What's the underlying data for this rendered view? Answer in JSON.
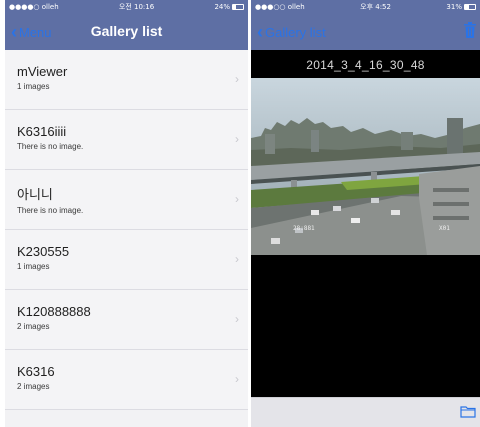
{
  "left": {
    "status": {
      "carrier": "●●●●○ olleh",
      "time": "오전 10:16",
      "battery": "24%"
    },
    "nav": {
      "back_label": "Menu",
      "title": "Gallery list"
    },
    "galleries": [
      {
        "name": "mViewer",
        "detail": "1 images"
      },
      {
        "name": "K6316iiii",
        "detail": "There is no image."
      },
      {
        "name": "아니니",
        "detail": "There is no image."
      },
      {
        "name": "K230555",
        "detail": "1 images"
      },
      {
        "name": "K120888888",
        "detail": "2 images"
      },
      {
        "name": "K6316",
        "detail": "2 images"
      }
    ]
  },
  "right": {
    "status": {
      "carrier": "●●●○○ olleh",
      "time": "오후 4:52",
      "battery": "31%"
    },
    "nav": {
      "back_label": "Gallery list"
    },
    "image_title": "2014_3_4_16_30_48",
    "overlay_labels": {
      "left": "28:881",
      "right": "X01"
    }
  },
  "colors": {
    "header": "#5e6fa4",
    "accent": "#2a73e6",
    "viewer_bg": "#000000",
    "list_bg": "#f4f4f6"
  },
  "icons": {
    "back": "chevron-left-icon",
    "trash": "trash-icon",
    "folder": "folder-icon",
    "wifi": "wifi-icon",
    "battery": "battery-icon"
  }
}
